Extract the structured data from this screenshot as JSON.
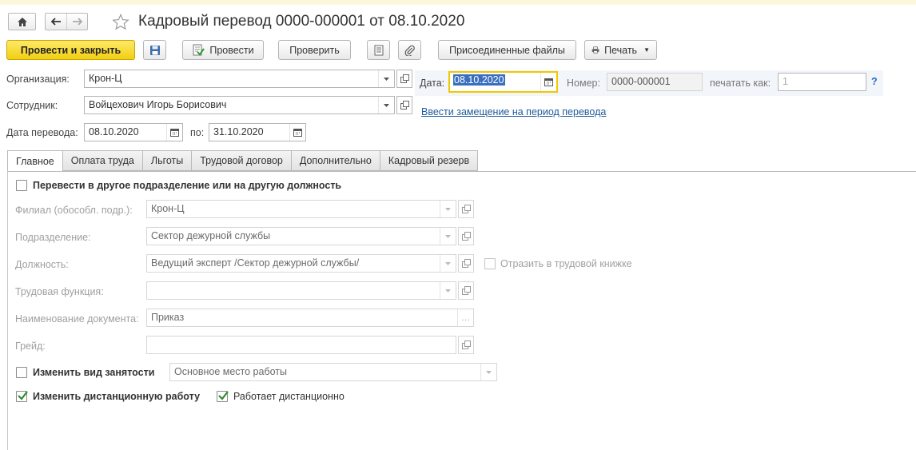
{
  "window": {
    "title": "Кадровый перевод 0000-000001 от 08.10.2020"
  },
  "toolbar": {
    "post_and_close": "Провести и закрыть",
    "post": "Провести",
    "check": "Проверить",
    "attached_files": "Присоединенные файлы",
    "print": "Печать"
  },
  "form": {
    "organization": {
      "label": "Организация:",
      "value": "Крон-Ц"
    },
    "employee": {
      "label": "Сотрудник:",
      "value": "Войцехович Игорь Борисович"
    },
    "transfer_date": {
      "label": "Дата перевода:",
      "value": "08.10.2020"
    },
    "to_date": {
      "label": "по:",
      "value": "31.10.2020"
    },
    "date": {
      "label": "Дата:",
      "value": "08.10.2020"
    },
    "number": {
      "label": "Номер:",
      "value": "0000-000001"
    },
    "print_as": {
      "label": "печатать как:",
      "value": "1"
    },
    "help": "?",
    "replacement_link": "Ввести замещение на период перевода"
  },
  "tabs": [
    {
      "label": "Главное",
      "active": true
    },
    {
      "label": "Оплата труда",
      "active": false
    },
    {
      "label": "Льготы",
      "active": false
    },
    {
      "label": "Трудовой договор",
      "active": false
    },
    {
      "label": "Дополнительно",
      "active": false
    },
    {
      "label": "Кадровый резерв",
      "active": false
    }
  ],
  "main": {
    "transfer_checkbox": {
      "label": "Перевести в другое подразделение или на другую должность",
      "checked": false
    },
    "branch": {
      "label": "Филиал (обособл. подр.):",
      "value": "Крон-Ц"
    },
    "department": {
      "label": "Подразделение:",
      "value": "Сектор дежурной службы"
    },
    "position": {
      "label": "Должность:",
      "value": "Ведущий эксперт /Сектор дежурной службы/"
    },
    "workbook_checkbox": {
      "label": "Отразить в трудовой книжке",
      "checked": false
    },
    "labor_function": {
      "label": "Трудовая функция:",
      "value": ""
    },
    "document_name": {
      "label": "Наименование документа:",
      "value": "Приказ"
    },
    "grade": {
      "label": "Грейд:",
      "value": ""
    },
    "employment_type_checkbox": {
      "label": "Изменить вид занятости",
      "checked": false
    },
    "employment_type": {
      "value": "Основное место работы"
    },
    "remote_work_checkbox": {
      "label": "Изменить дистанционную работу",
      "checked": true
    },
    "works_remotely_checkbox": {
      "label": "Работает дистанционно",
      "checked": true
    }
  },
  "colors": {
    "primary_button": "#f2cf12",
    "link": "#1f5a9c",
    "focus_border": "#f0c800",
    "selection": "#3a6fc0",
    "checkmark": "#2e8b2e"
  }
}
